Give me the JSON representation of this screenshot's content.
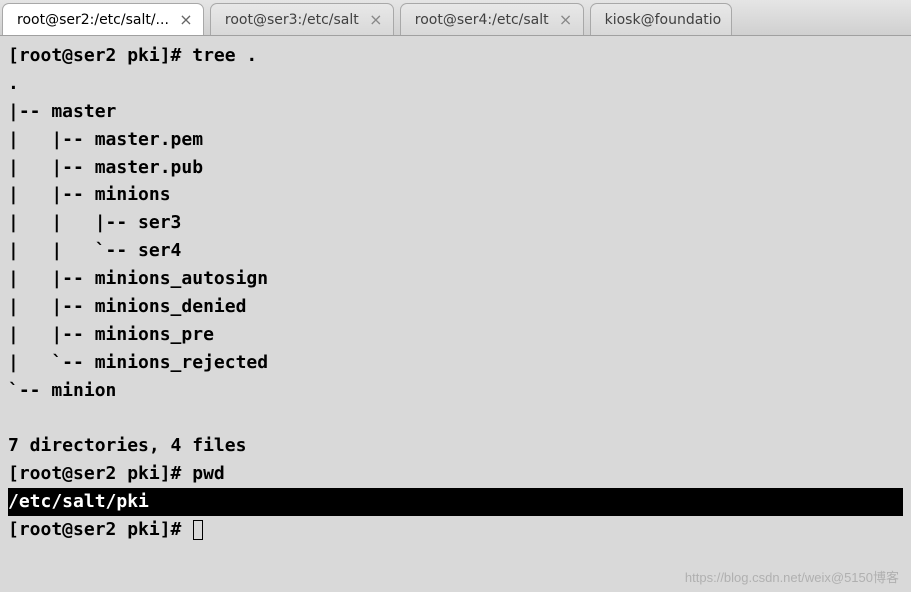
{
  "tabs": [
    {
      "label": "root@ser2:/etc/salt/...",
      "active": true
    },
    {
      "label": "root@ser3:/etc/salt",
      "active": false
    },
    {
      "label": "root@ser4:/etc/salt",
      "active": false
    },
    {
      "label": "kiosk@foundatio",
      "active": false
    }
  ],
  "terminal": {
    "prompt1": "[root@ser2 pki]# ",
    "cmd1": "tree .",
    "tree_lines": [
      ".",
      "|-- master",
      "|   |-- master.pem",
      "|   |-- master.pub",
      "|   |-- minions",
      "|   |   |-- ser3",
      "|   |   `-- ser4",
      "|   |-- minions_autosign",
      "|   |-- minions_denied",
      "|   |-- minions_pre",
      "|   `-- minions_rejected",
      "`-- minion"
    ],
    "summary": "7 directories, 4 files",
    "prompt2": "[root@ser2 pki]# ",
    "cmd2": "pwd",
    "pwd_output": "/etc/salt/pki",
    "prompt3": "[root@ser2 pki]# "
  },
  "watermark": "https://blog.csdn.net/weix@5150博客"
}
